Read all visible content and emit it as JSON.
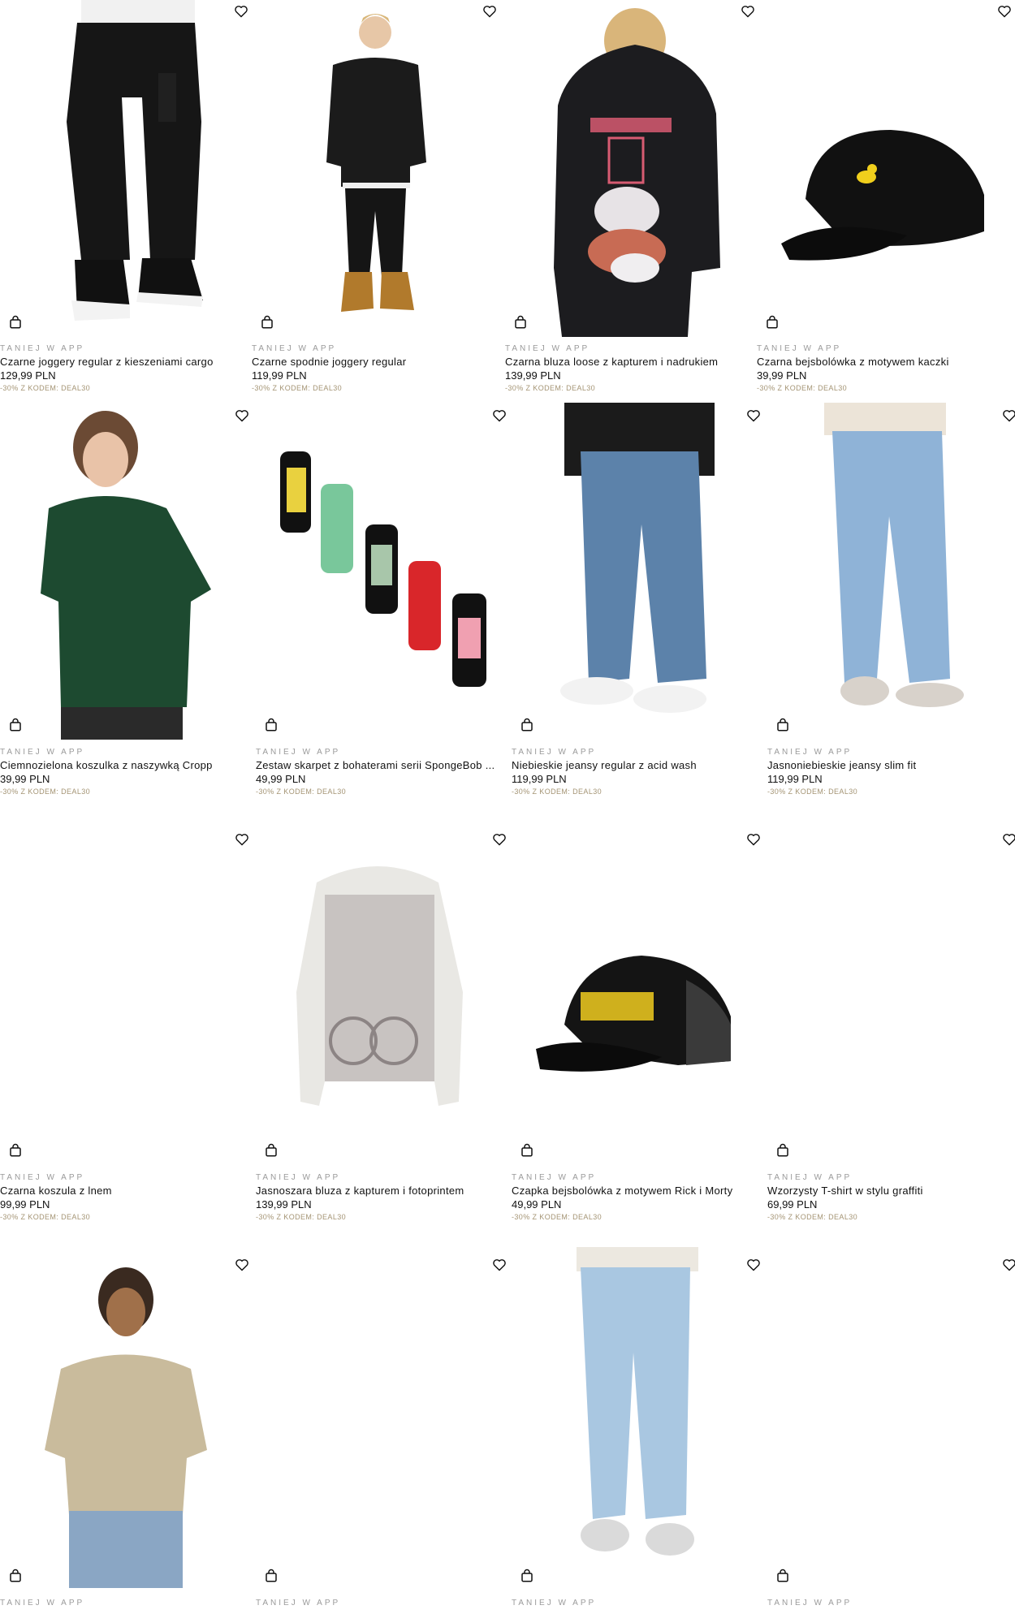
{
  "colors": {
    "promo": "#9a9a9a",
    "code": "#a49474",
    "text": "#111111"
  },
  "icons": {
    "wishlist": "heart-outline-icon",
    "cart": "shopping-bag-icon"
  },
  "products": [
    {
      "promo": "TANIEJ W APP",
      "title": "Czarne joggery regular z kieszeniami cargo",
      "price": "129,99 PLN",
      "code": "-30% Z KODEM: DEAL30"
    },
    {
      "promo": "TANIEJ W APP",
      "title": "Czarne spodnie joggery regular",
      "price": "119,99 PLN",
      "code": "-30% Z KODEM: DEAL30"
    },
    {
      "promo": "TANIEJ W APP",
      "title": "Czarna bluza loose z kapturem i nadrukiem",
      "price": "139,99 PLN",
      "code": "-30% Z KODEM: DEAL30"
    },
    {
      "promo": "TANIEJ W APP",
      "title": "Czarna bejsbolówka z motywem kaczki",
      "price": "39,99 PLN",
      "code": "-30% Z KODEM: DEAL30"
    },
    {
      "promo": "TANIEJ W APP",
      "title": "Ciemnozielona koszulka z naszywką Cropp",
      "price": "39,99 PLN",
      "code": "-30% Z KODEM: DEAL30"
    },
    {
      "promo": "TANIEJ W APP",
      "title": "Zestaw skarpet z bohaterami serii SpongeBob ...",
      "price": "49,99 PLN",
      "code": "-30% Z KODEM: DEAL30"
    },
    {
      "promo": "TANIEJ W APP",
      "title": "Niebieskie jeansy regular z acid wash",
      "price": "119,99 PLN",
      "code": "-30% Z KODEM: DEAL30"
    },
    {
      "promo": "TANIEJ W APP",
      "title": "Jasnoniebieskie jeansy slim fit",
      "price": "119,99 PLN",
      "code": "-30% Z KODEM: DEAL30"
    },
    {
      "promo": "TANIEJ W APP",
      "title": "Czarna koszula z lnem",
      "price": "99,99 PLN",
      "code": "-30% Z KODEM: DEAL30"
    },
    {
      "promo": "TANIEJ W APP",
      "title": "Jasnoszara bluza z kapturem i fotoprintem",
      "price": "139,99 PLN",
      "code": "-30% Z KODEM: DEAL30"
    },
    {
      "promo": "TANIEJ W APP",
      "title": "Czapka bejsbolówka z motywem Rick i Morty",
      "price": "49,99 PLN",
      "code": "-30% Z KODEM: DEAL30"
    },
    {
      "promo": "TANIEJ W APP",
      "title": "Wzorzysty T-shirt w stylu graffiti",
      "price": "69,99 PLN",
      "code": "-30% Z KODEM: DEAL30"
    },
    {
      "promo": "TANIEJ W APP"
    },
    {
      "promo": "TANIEJ W APP"
    },
    {
      "promo": "TANIEJ W APP"
    },
    {
      "promo": "TANIEJ W APP"
    }
  ]
}
